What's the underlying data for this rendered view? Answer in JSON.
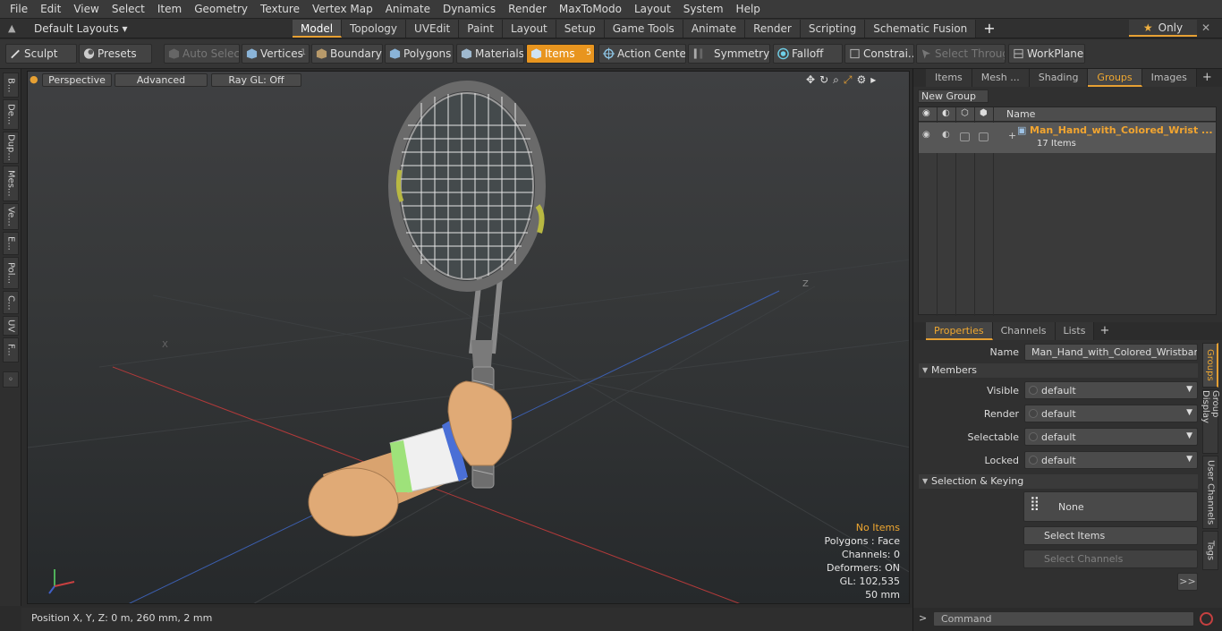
{
  "menu": [
    "File",
    "Edit",
    "View",
    "Select",
    "Item",
    "Geometry",
    "Texture",
    "Vertex Map",
    "Animate",
    "Dynamics",
    "Render",
    "MaxToModo",
    "Layout",
    "System",
    "Help"
  ],
  "layout_selector": "Default Layouts",
  "mode_tabs": [
    "Model",
    "Topology",
    "UVEdit",
    "Paint",
    "Layout",
    "Setup",
    "Game Tools",
    "Animate",
    "Render",
    "Scripting",
    "Schematic Fusion"
  ],
  "active_mode_tab": "Model",
  "only_label": "Only",
  "toolbar": {
    "sculpt": "Sculpt",
    "presets": "Presets",
    "auto_select": "Auto Select",
    "vertices": "Vertices",
    "vertices_count": "1",
    "boundary": "Boundary",
    "polygons": "Polygons",
    "materials": "Materials",
    "items": "Items",
    "items_count": "5",
    "action_center": "Action Center",
    "symmetry": "Symmetry",
    "falloff": "Falloff",
    "constraints": "Constrai...",
    "select_through": "Select Through",
    "workplane": "WorkPlane"
  },
  "left_tabs": [
    "B...",
    "De...",
    "Dup...",
    "Mes...",
    "Ve...",
    "E...",
    "Pol...",
    "C...",
    "UV",
    "F..."
  ],
  "viewport": {
    "perspective": "Perspective",
    "advanced": "Advanced",
    "raygl": "Ray GL: Off",
    "info": {
      "no_items": "No Items",
      "polygons": "Polygons : Face",
      "channels": "Channels: 0",
      "deformers": "Deformers: ON",
      "gl": "GL: 102,535",
      "scale": "50 mm"
    },
    "axis_z": "Z",
    "axis_x": "X"
  },
  "status": {
    "position": "Position X, Y, Z:   0 m, 260 mm, 2 mm"
  },
  "right_tabs": [
    "Items",
    "Mesh ...",
    "Shading",
    "Groups",
    "Images"
  ],
  "active_right_tab": "Groups",
  "groups": {
    "new_group": "New Group",
    "col_name": "Name",
    "row_name": "Man_Hand_with_Colored_Wrist ...",
    "row_count": "17 Items"
  },
  "prop_tabs": [
    "Properties",
    "Channels",
    "Lists"
  ],
  "properties": {
    "name_label": "Name",
    "name_value": "Man_Hand_with_Colored_Wristband_",
    "members": "Members",
    "visible_label": "Visible",
    "visible_value": "default",
    "render_label": "Render",
    "render_value": "default",
    "selectable_label": "Selectable",
    "selectable_value": "default",
    "locked_label": "Locked",
    "locked_value": "default",
    "selection_keying": "Selection & Keying",
    "none_btn": "None",
    "select_items": "Select Items",
    "select_channels": "Select Channels",
    "more": ">>"
  },
  "side_tabs": [
    "Groups",
    "Group Display",
    "User Channels",
    "Tags"
  ],
  "command_placeholder": "Command",
  "colors": {
    "accent": "#e6a033",
    "active_button": "#e8951f"
  }
}
